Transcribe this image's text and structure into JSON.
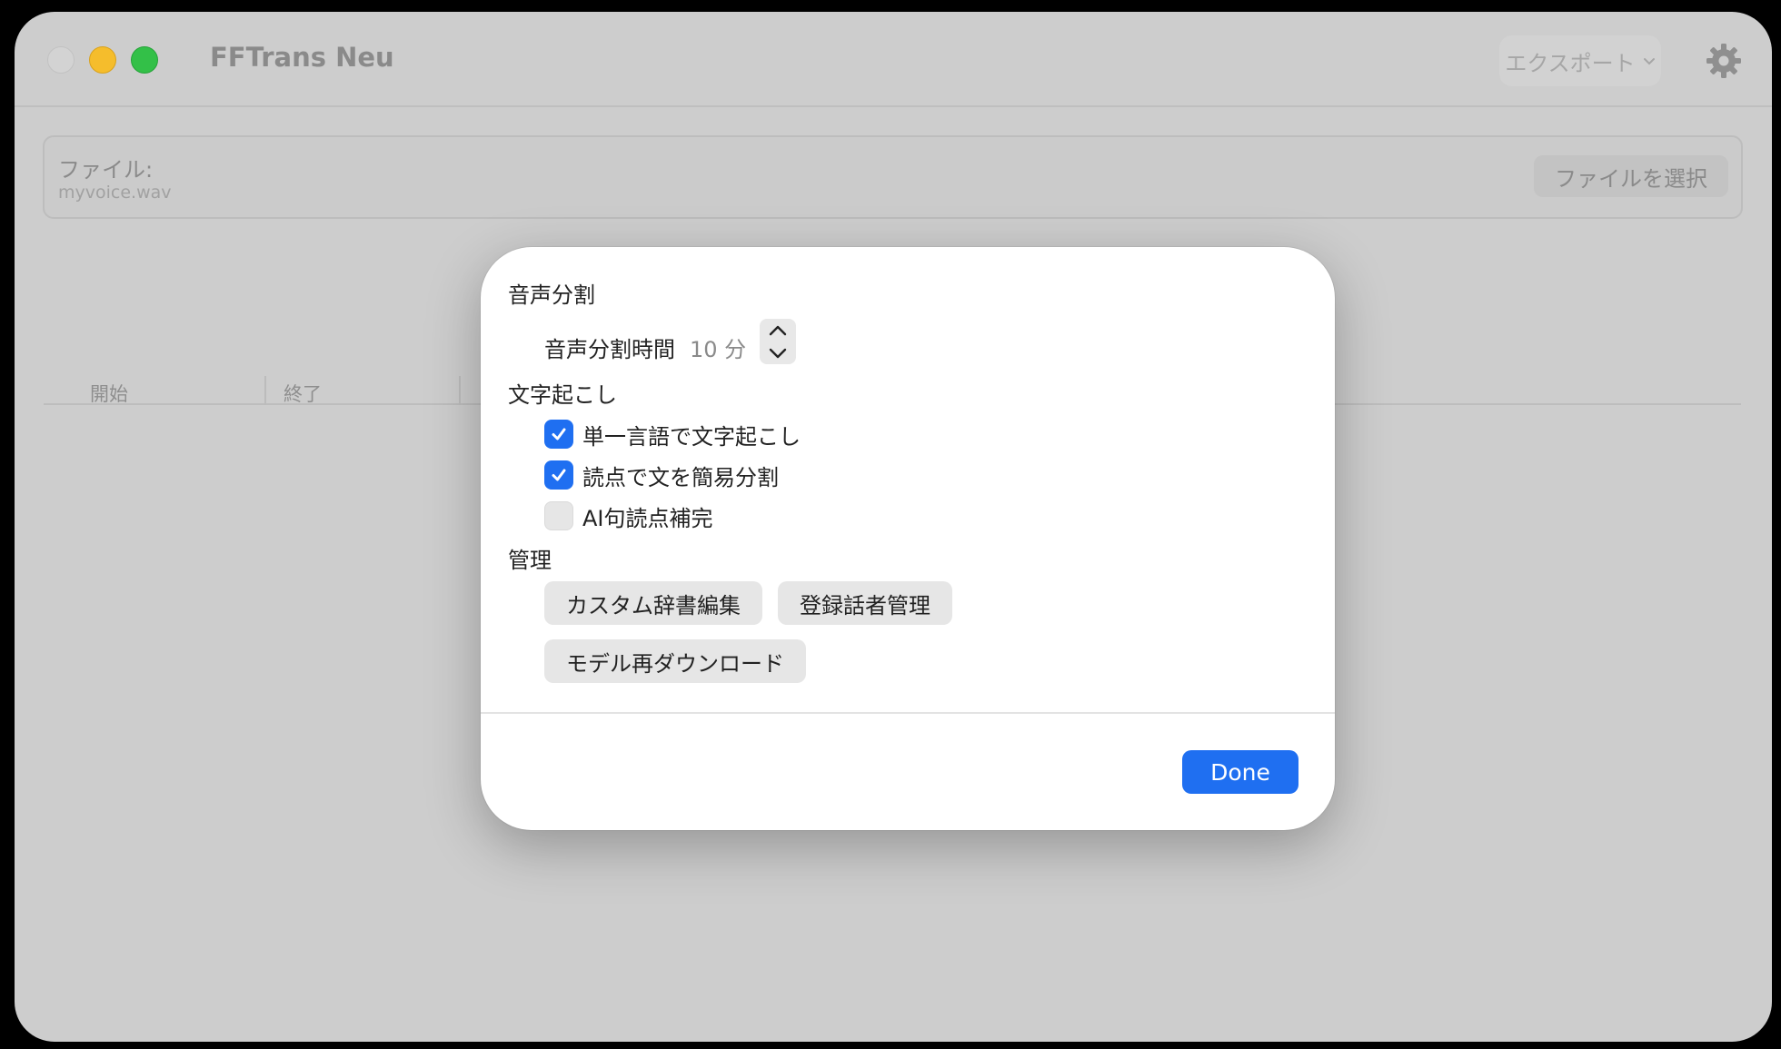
{
  "app": {
    "title": "FFTrans Neu"
  },
  "toolbar": {
    "export_label": "エクスポート",
    "export_chevron": "chevron-down-icon",
    "settings_icon": "gear-icon"
  },
  "file_panel": {
    "label": "ファイル:",
    "file_name": "myvoice.wav",
    "choose_button": "ファイルを選択"
  },
  "table": {
    "columns": [
      "開始",
      "終了"
    ]
  },
  "settings_modal": {
    "sections": {
      "split": {
        "title": "音声分割",
        "duration_label": "音声分割時間",
        "duration_value": "10 分"
      },
      "transcription": {
        "title": "文字起こし",
        "options": [
          {
            "label": "単一言語で文字起こし",
            "checked": true
          },
          {
            "label": "読点で文を簡易分割",
            "checked": true
          },
          {
            "label": "AI句読点補完",
            "checked": false
          }
        ]
      },
      "management": {
        "title": "管理",
        "buttons": [
          "カスタム辞書編集",
          "登録話者管理",
          "モデル再ダウンロード"
        ]
      }
    },
    "done_label": "Done"
  },
  "colors": {
    "accent": "#1f6ff1",
    "window_dimmed": "#cdcdcd",
    "traffic_min": "#f5bd2c",
    "traffic_max": "#33c048"
  }
}
